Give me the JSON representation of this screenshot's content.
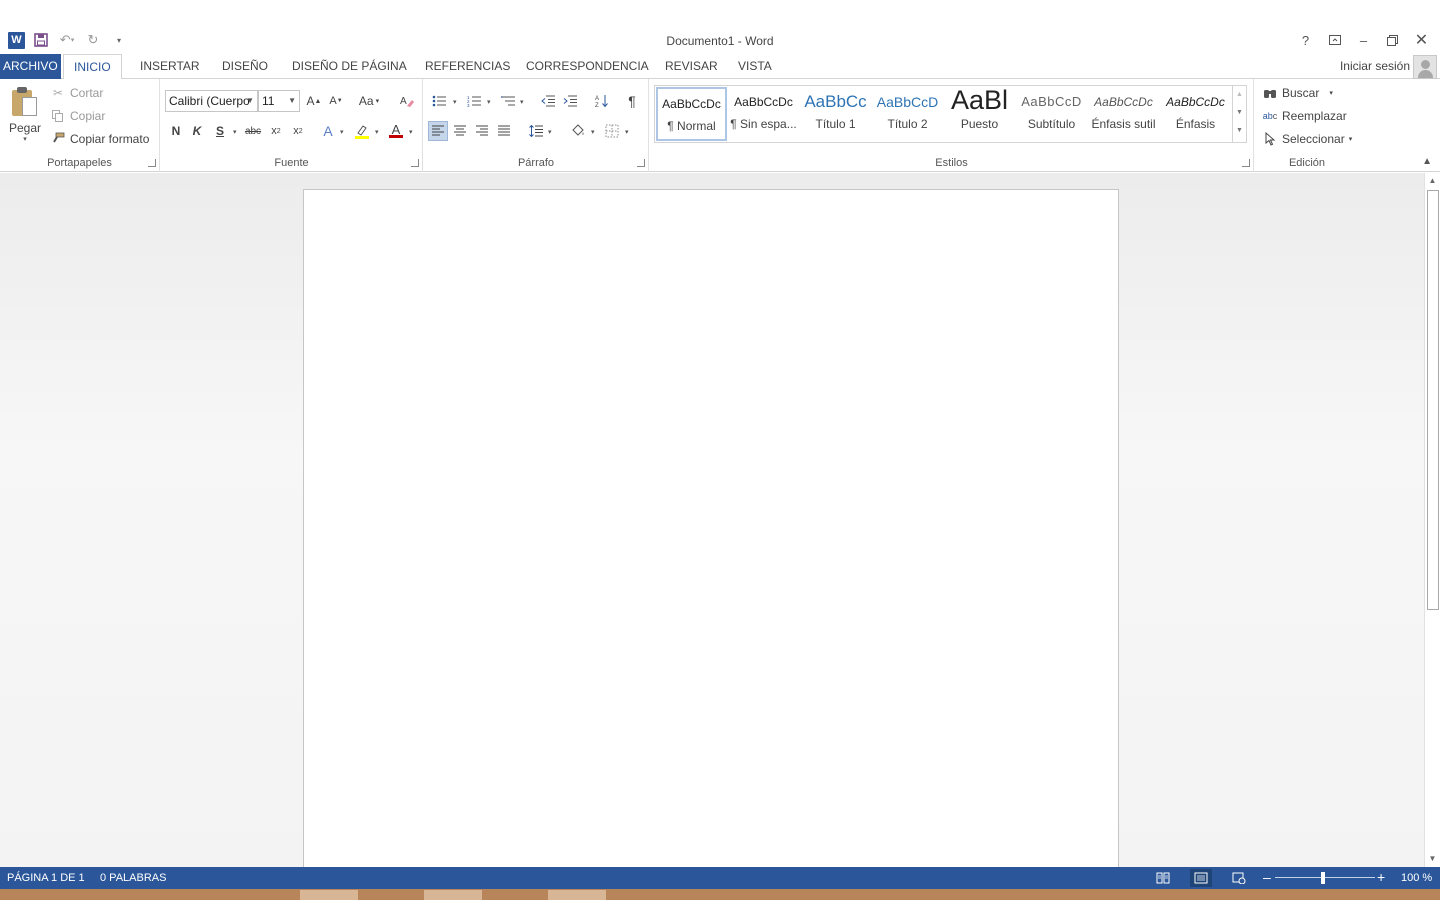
{
  "window": {
    "title": "Documento1 - Word"
  },
  "tabs": [
    {
      "label": "ARCHIVO"
    },
    {
      "label": "INICIO"
    },
    {
      "label": "INSERTAR"
    },
    {
      "label": "DISEÑO"
    },
    {
      "label": "DISEÑO DE PÁGINA"
    },
    {
      "label": "REFERENCIAS"
    },
    {
      "label": "CORRESPONDENCIA"
    },
    {
      "label": "REVISAR"
    },
    {
      "label": "VISTA"
    }
  ],
  "account": {
    "signin_label": "Iniciar sesión"
  },
  "ribbon": {
    "clipboard": {
      "label": "Portapapeles",
      "paste": "Pegar",
      "cut": "Cortar",
      "copy": "Copiar",
      "format_painter": "Copiar formato"
    },
    "font": {
      "label": "Fuente",
      "font_name": "Calibri (Cuerpo",
      "font_size": "11",
      "bold": "N",
      "italic": "K",
      "underline": "S",
      "strike": "abc",
      "change_case": "Aa"
    },
    "paragraph": {
      "label": "Párrafo",
      "pilcrow": "¶"
    },
    "styles": {
      "label": "Estilos",
      "items": [
        {
          "sample": "AaBbCcDc",
          "name": "¶ Normal"
        },
        {
          "sample": "AaBbCcDc",
          "name": "¶ Sin espa..."
        },
        {
          "sample": "AaBbCc",
          "name": "Título 1"
        },
        {
          "sample": "AaBbCcD",
          "name": "Título 2"
        },
        {
          "sample": "AaBl",
          "name": "Puesto"
        },
        {
          "sample": "AaBbCcD",
          "name": "Subtítulo"
        },
        {
          "sample": "AaBbCcDc",
          "name": "Énfasis sutil"
        },
        {
          "sample": "AaBbCcDc",
          "name": "Énfasis"
        }
      ]
    },
    "editing": {
      "label": "Edición",
      "find": "Buscar",
      "replace": "Reemplazar",
      "select": "Seleccionar"
    }
  },
  "statusbar": {
    "page": "PÁGINA 1 DE 1",
    "words": "0 PALABRAS",
    "zoom": "100 %"
  },
  "colors": {
    "accent": "#2b579a",
    "font_color_swatch": "#c00000",
    "highlight_swatch": "#ffff00"
  }
}
